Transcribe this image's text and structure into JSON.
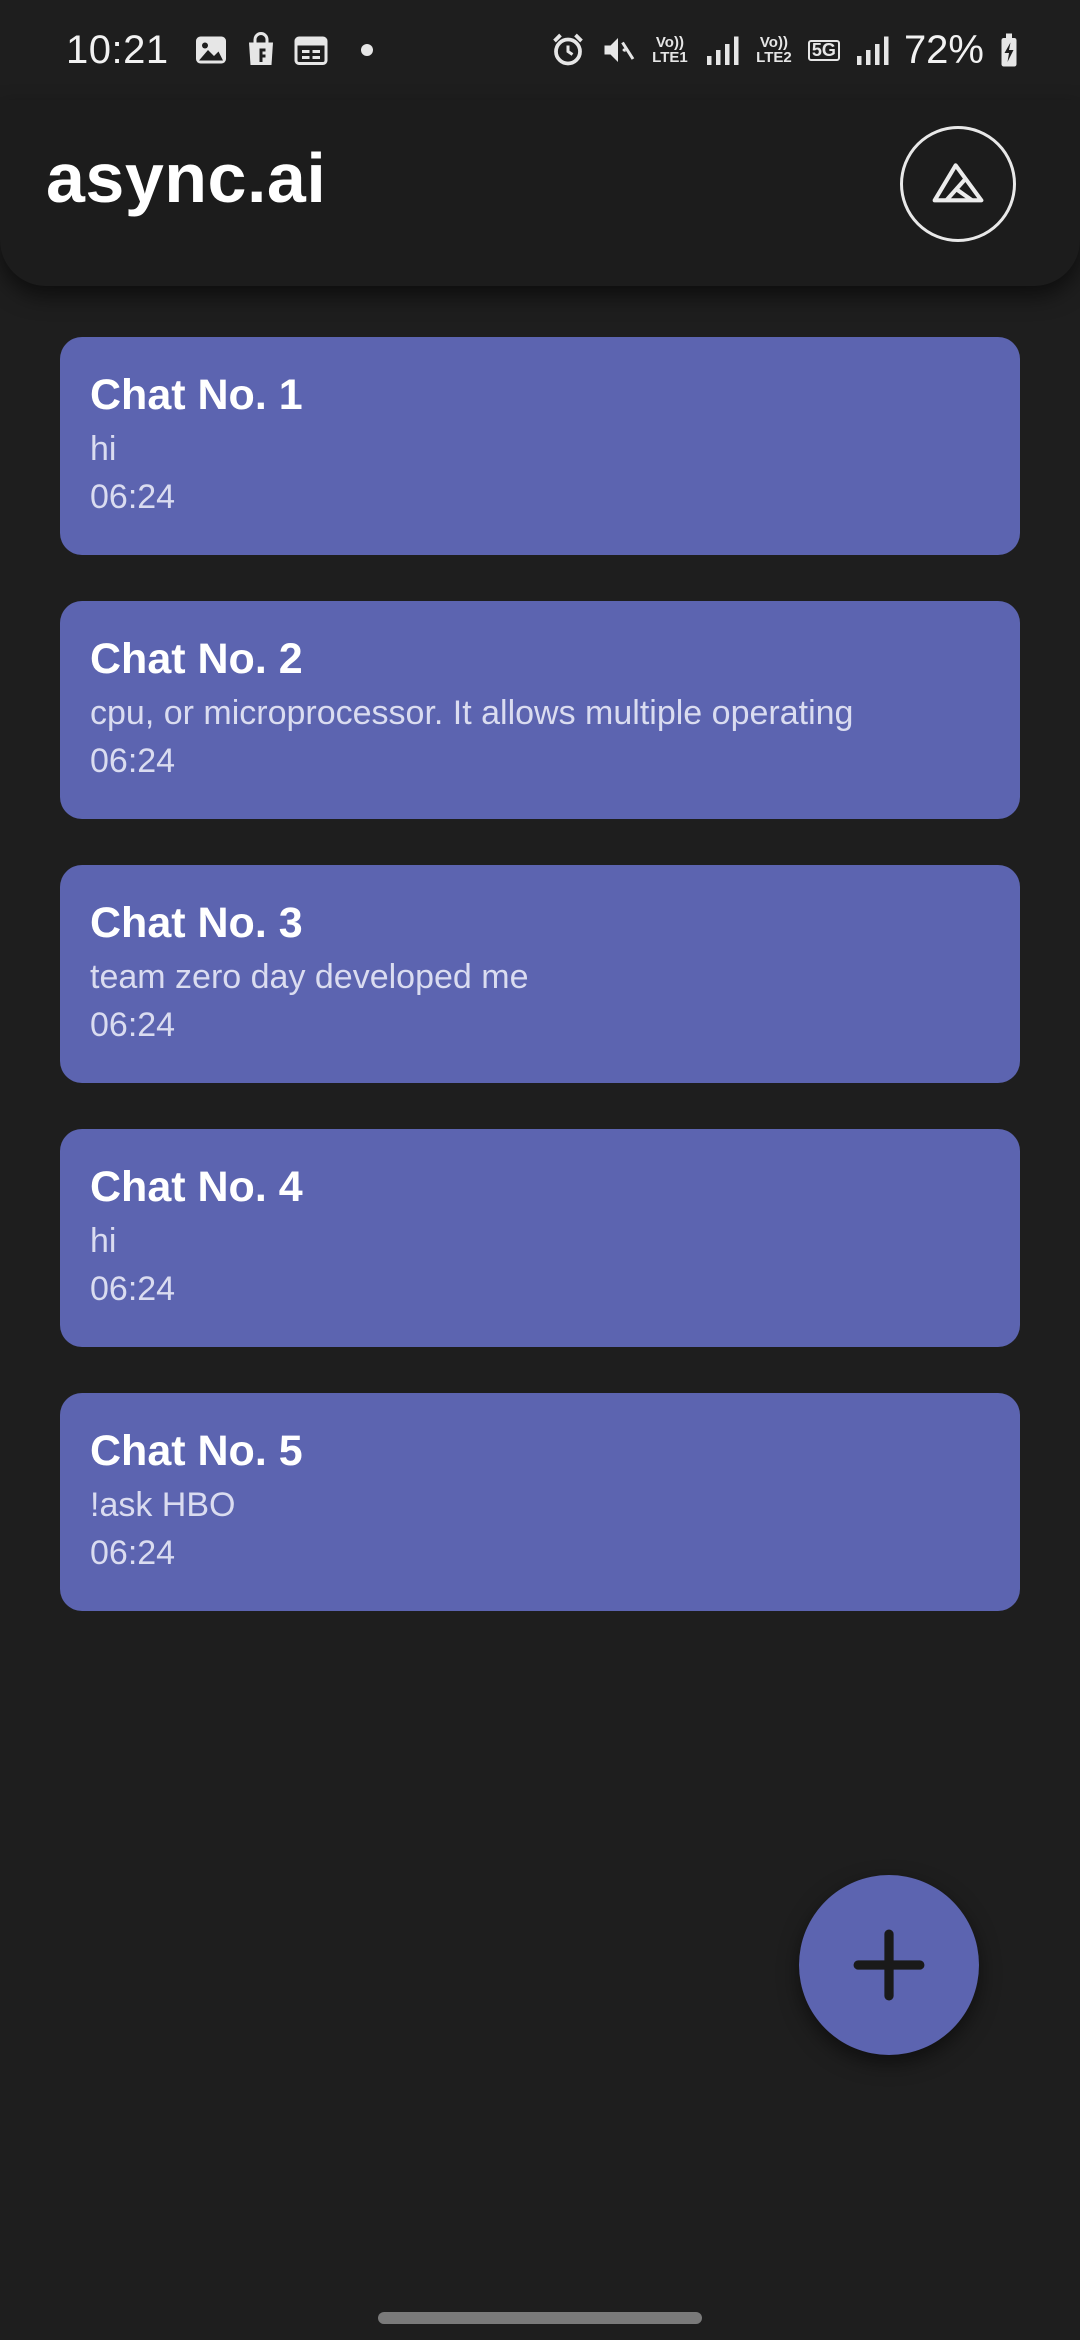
{
  "status_bar": {
    "time": "10:21",
    "left_icons": [
      "image-icon",
      "shopping-bag-icon",
      "calendar-icon"
    ],
    "right_icons": [
      "alarm-icon",
      "mute-icon",
      "volte-lte1-icon",
      "signal-1-icon",
      "volte-lte2-icon",
      "network-5g-icon",
      "signal-2-icon",
      "battery-charging-icon"
    ],
    "volte1_label": "Vo)) LTE1",
    "volte2_label": "Vo)) LTE2",
    "network_label": "5G",
    "battery": "72%"
  },
  "app_bar": {
    "title": "async.ai",
    "theme_button_icon": "triangle-logo-icon"
  },
  "chats": [
    {
      "title": "Chat No. 1",
      "preview": "hi",
      "time": "06:24"
    },
    {
      "title": "Chat No. 2",
      "preview": "cpu, or microprocessor. It allows multiple operating",
      "time": "06:24"
    },
    {
      "title": "Chat No. 3",
      "preview": "team zero day developed me",
      "time": "06:24"
    },
    {
      "title": "Chat No. 4",
      "preview": "hi",
      "time": "06:24"
    },
    {
      "title": "Chat No. 5",
      "preview": "!ask HBO",
      "time": "06:24"
    }
  ],
  "fab": {
    "icon": "plus-icon"
  },
  "colors": {
    "background": "#1e1e1e",
    "app_bar": "#1c1c1c",
    "card": "#5c64b0",
    "card_secondary_text": "#dadcf0",
    "fab": "#5c64b0",
    "fab_icon": "#1a1a1a"
  }
}
